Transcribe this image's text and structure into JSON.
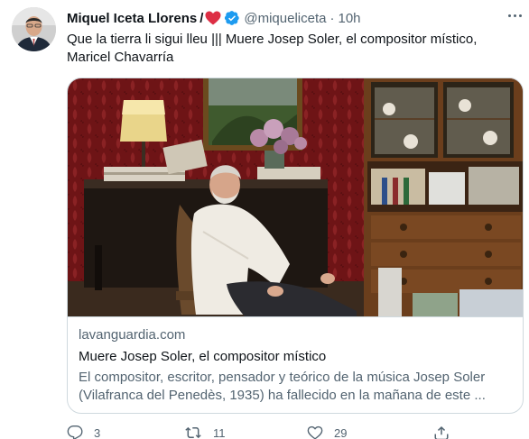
{
  "author": {
    "name": "Miquel Iceta Llorens",
    "name_suffix": "/",
    "handle": "@miqueliceta",
    "separator": "·",
    "time": "10h"
  },
  "tweet": {
    "text": "Que la tierra li sigui lleu ||| Muere Josep Soler, el compositor místico, Maricel Chavarría"
  },
  "card": {
    "domain": "lavanguardia.com",
    "title": "Muere Josep Soler, el compositor místico",
    "description": "El compositor, escritor, pensador y teórico de la música Josep Soler (Vilafranca del Penedès, 1935) ha fallecido en la mañana de este ..."
  },
  "actions": {
    "reply_count": "3",
    "retweet_count": "11",
    "like_count": "29"
  },
  "icons": {
    "avatar": "avatar-portrait",
    "heart": "heart-emoji-icon",
    "verified": "verified-badge-icon",
    "more": "more-options-icon",
    "reply": "reply-icon",
    "retweet": "retweet-icon",
    "like": "like-icon",
    "share": "share-icon"
  },
  "colors": {
    "text_primary": "#0f1419",
    "text_secondary": "#536471",
    "border": "#cfd9de",
    "verified_blue": "#1d9bf0",
    "heart_red": "#dd2e44"
  }
}
